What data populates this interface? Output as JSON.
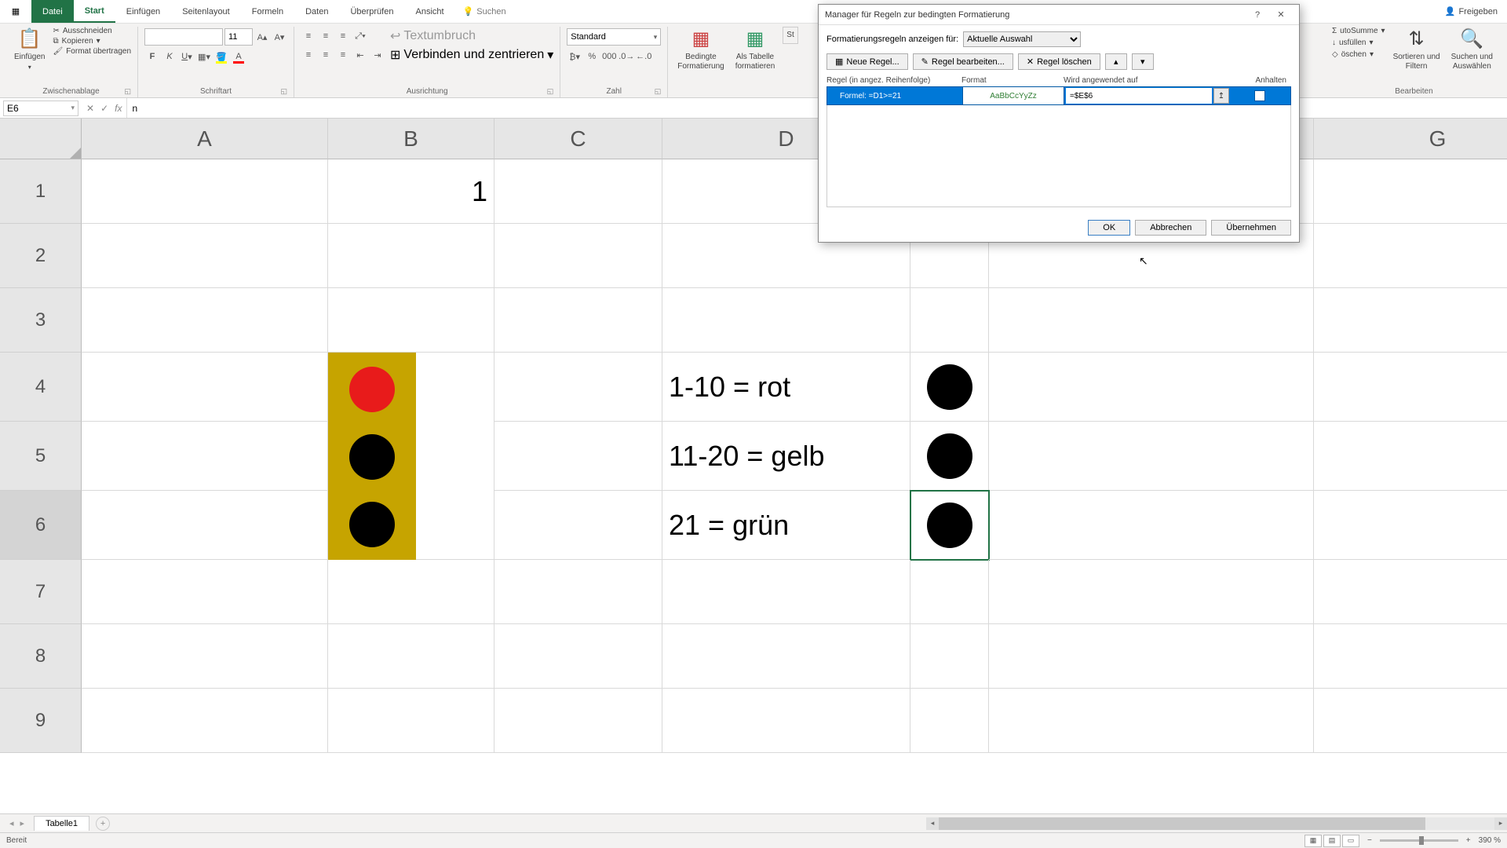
{
  "tabs": {
    "file": "Datei",
    "home": "Start",
    "insert": "Einfügen",
    "layout": "Seitenlayout",
    "formulas": "Formeln",
    "data": "Daten",
    "review": "Überprüfen",
    "view": "Ansicht",
    "tell": "Suchen"
  },
  "share": "Freigeben",
  "clipboard": {
    "paste": "Einfügen",
    "cut": "Ausschneiden",
    "copy": "Kopieren",
    "painter": "Format übertragen",
    "label": "Zwischenablage"
  },
  "font": {
    "name": "",
    "size": "11",
    "label": "Schriftart"
  },
  "align": {
    "wrap": "Textumbruch",
    "merge": "Verbinden und zentrieren",
    "label": "Ausrichtung"
  },
  "number": {
    "format": "Standard",
    "label": "Zahl"
  },
  "styles": {
    "cond": "Bedingte\nFormatierung",
    "table": "Als Tabelle\nformatieren",
    "cell": "St"
  },
  "editing": {
    "sum": "utoSumme",
    "fill": "usfüllen",
    "clear": "öschen",
    "sort": "Sortieren und\nFiltern",
    "find": "Suchen und\nAuswählen",
    "label": "Bearbeiten"
  },
  "namebox": "E6",
  "formula": "n",
  "cols": [
    "A",
    "B",
    "C",
    "D",
    "G"
  ],
  "rows": [
    "1",
    "2",
    "3",
    "4",
    "5",
    "6",
    "7",
    "8",
    "9"
  ],
  "cells": {
    "b1": "1",
    "d4": "1-10 = rot",
    "d5": "11-20 = gelb",
    "d6": "21 = grün"
  },
  "sheet": "Tabelle1",
  "status": "Bereit",
  "zoom": "390 %",
  "dlg": {
    "title": "Manager für Regeln zur bedingten Formatierung",
    "showfor": "Formatierungsregeln anzeigen für:",
    "scope": "Aktuelle Auswahl",
    "new": "Neue Regel...",
    "edit": "Regel bearbeiten...",
    "delete": "Regel löschen",
    "h1": "Regel (in angez. Reihenfolge)",
    "h2": "Format",
    "h3": "Wird angewendet auf",
    "h4": "Anhalten",
    "rule_desc": "Formel: =D1>=21",
    "rule_fmt": "AaBbCcYyZz",
    "rule_range": "=$E$6",
    "ok": "OK",
    "cancel": "Abbrechen",
    "apply": "Übernehmen"
  }
}
